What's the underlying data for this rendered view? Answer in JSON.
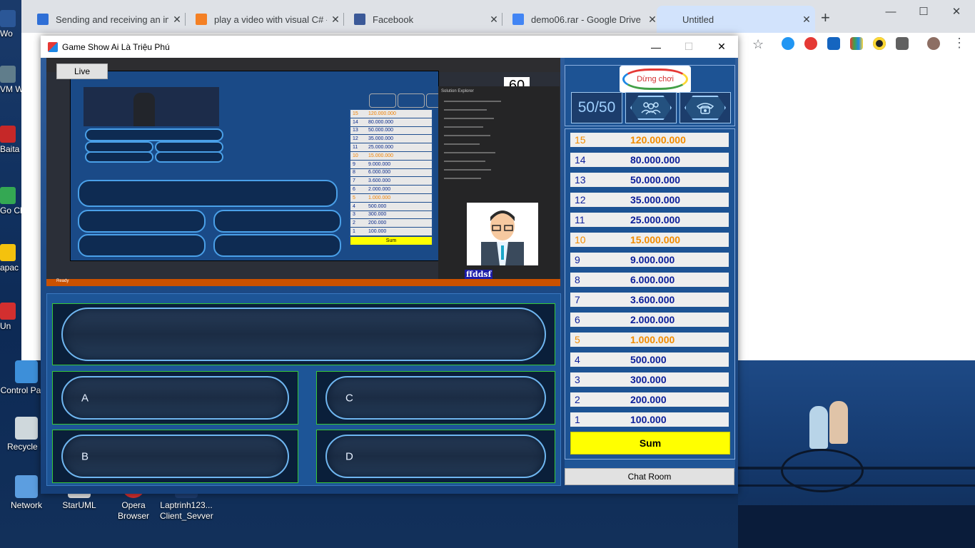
{
  "browser": {
    "tabs": [
      {
        "title": "Sending and receiving an ima",
        "color": "#2f6fd6"
      },
      {
        "title": "play a video with visual C# - S",
        "color": "#f48024"
      },
      {
        "title": "Facebook",
        "color": "#3b5998"
      },
      {
        "title": "demo06.rar - Google Drive",
        "color": "#4285f4"
      },
      {
        "title": "Untitled",
        "color": "#d2e3fc"
      }
    ],
    "newtab": "+",
    "controls": {
      "minimize": "—",
      "maximize": "☐",
      "close": "✕"
    }
  },
  "desktop": {
    "left_icons": [
      "Wo",
      "VM Wor",
      "Baita",
      "Go Ch",
      "apac",
      "Un"
    ],
    "bottom_icons": [
      {
        "label": "Control Panel"
      },
      {
        "label": "Recycle B"
      },
      {
        "label": "Network"
      },
      {
        "label": "StarUML"
      },
      {
        "label": "Opera Browser"
      },
      {
        "label": "Laptrinh123... Client_Sevver"
      }
    ]
  },
  "game": {
    "title": "Game Show Ai Là Triệu Phú",
    "controls": {
      "minimize": "—",
      "maximize": "☐",
      "close": "✕"
    },
    "live_label": "Live",
    "stream_timer": "60",
    "stream_nameplate": "ffddsf",
    "stream_sidepanel_title": "Solution Explorer",
    "stream_status": "Ready",
    "question": "",
    "answers": {
      "a": {
        "label": "A",
        "text": ""
      },
      "b": {
        "label": "B",
        "text": ""
      },
      "c": {
        "label": "C",
        "text": ""
      },
      "d": {
        "label": "D",
        "text": ""
      }
    },
    "stop_label": "Dừng chơi",
    "lifelines": {
      "fifty": "50/50",
      "audience": "audience-icon",
      "phone": "phone-icon"
    },
    "ladder": [
      {
        "level": "15",
        "amount": "120.000.000",
        "milestone": true
      },
      {
        "level": "14",
        "amount": "80.000.000",
        "milestone": false
      },
      {
        "level": "13",
        "amount": "50.000.000",
        "milestone": false
      },
      {
        "level": "12",
        "amount": "35.000.000",
        "milestone": false
      },
      {
        "level": "11",
        "amount": "25.000.000",
        "milestone": false
      },
      {
        "level": "10",
        "amount": "15.000.000",
        "milestone": true
      },
      {
        "level": "9",
        "amount": "9.000.000",
        "milestone": false
      },
      {
        "level": "8",
        "amount": "6.000.000",
        "milestone": false
      },
      {
        "level": "7",
        "amount": "3.600.000",
        "milestone": false
      },
      {
        "level": "6",
        "amount": "2.000.000",
        "milestone": false
      },
      {
        "level": "5",
        "amount": "1.000.000",
        "milestone": true
      },
      {
        "level": "4",
        "amount": "500.000",
        "milestone": false
      },
      {
        "level": "3",
        "amount": "300.000",
        "milestone": false
      },
      {
        "level": "2",
        "amount": "200.000",
        "milestone": false
      },
      {
        "level": "1",
        "amount": "100.000",
        "milestone": false
      }
    ],
    "sum_label": "Sum",
    "chat_label": "Chat Room"
  },
  "colors": {
    "milestone": "#f28c00",
    "normal": "#0b1f9a",
    "sum": "#ffff00"
  }
}
